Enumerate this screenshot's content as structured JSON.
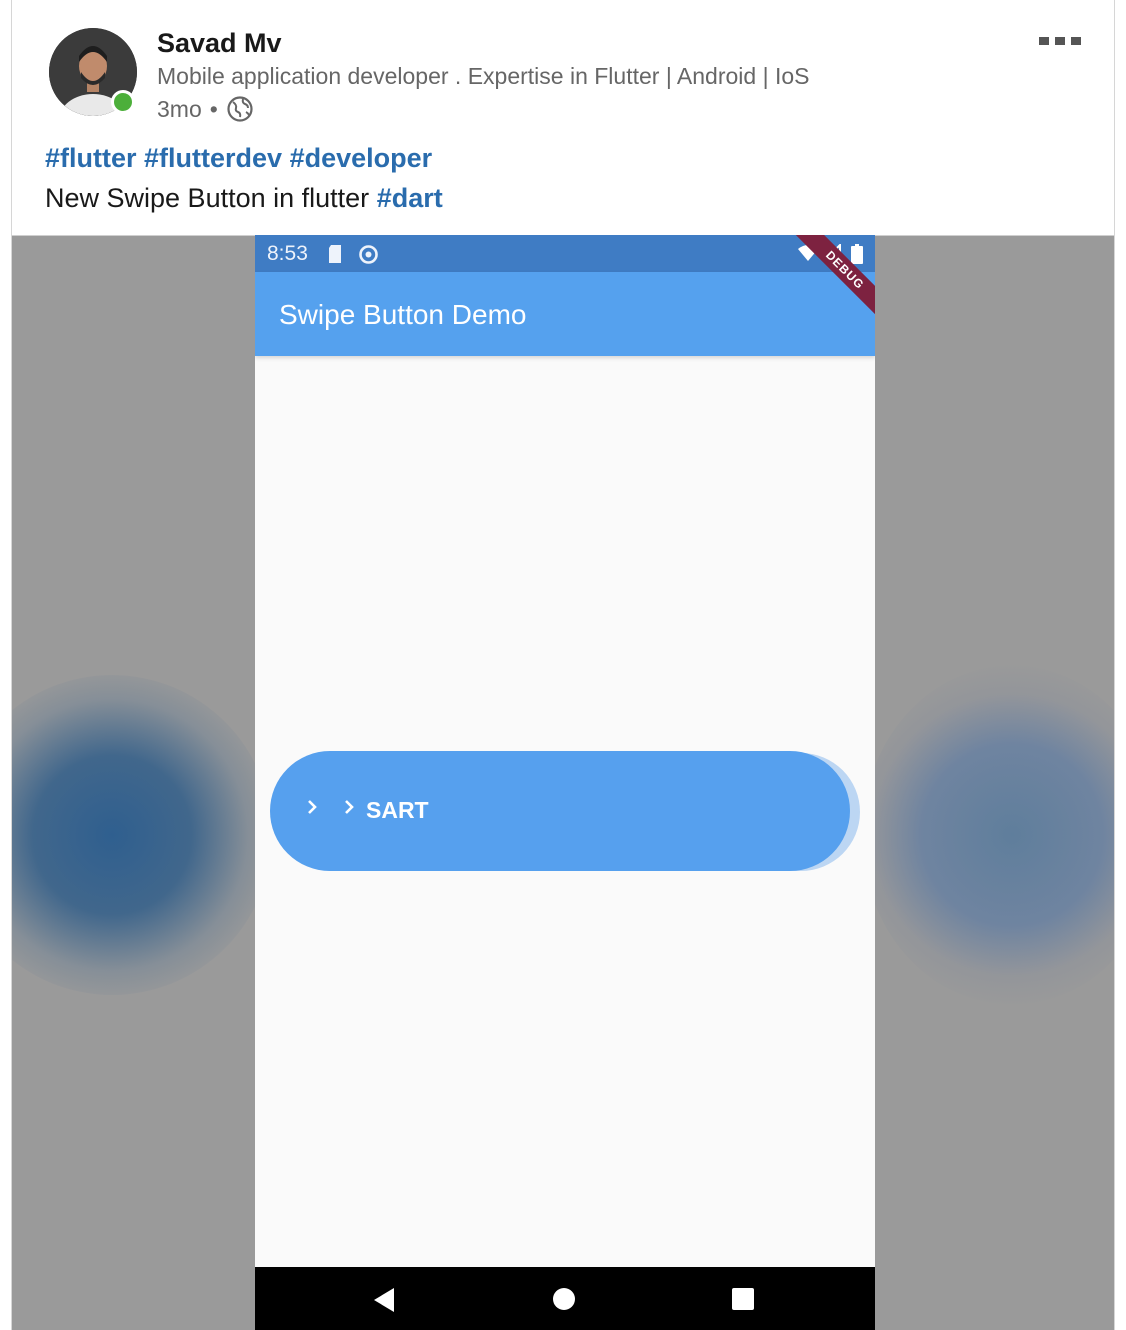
{
  "post": {
    "author": {
      "name": "Savad Mv",
      "headline": "Mobile application developer . Expertise in Flutter | Android | IoS",
      "time": "3mo",
      "separator": "•"
    },
    "hashtags": [
      "#flutter",
      "#flutterdev",
      "#developer"
    ],
    "text": "New Swipe Button in flutter",
    "text_hashtag": "#dart",
    "menu_icon": "more-horizontal-icon",
    "visibility_icon": "globe-icon"
  },
  "video": {
    "status_bar": {
      "time": "8:53",
      "left_icons": [
        "sd-card-icon",
        "sync-icon"
      ],
      "right_icons": [
        "wifi-icon",
        "signal-icon",
        "battery-icon"
      ]
    },
    "app_bar": {
      "title": "Swipe Button Demo"
    },
    "debug_banner": "DEBUG",
    "swipe_button": {
      "label": "SART",
      "icons": [
        "chevron-right-icon",
        "chevron-right-icon"
      ]
    },
    "nav_bar": {
      "icons": [
        "back-icon",
        "home-icon",
        "recents-icon"
      ]
    }
  },
  "colors": {
    "link": "#2a6cad",
    "presence": "#4caf3a",
    "status_bar": "#3f7cc4",
    "app_bar": "#55a1ee",
    "swipe_button": "#56a0ee",
    "debug_banner": "#7d2240"
  }
}
